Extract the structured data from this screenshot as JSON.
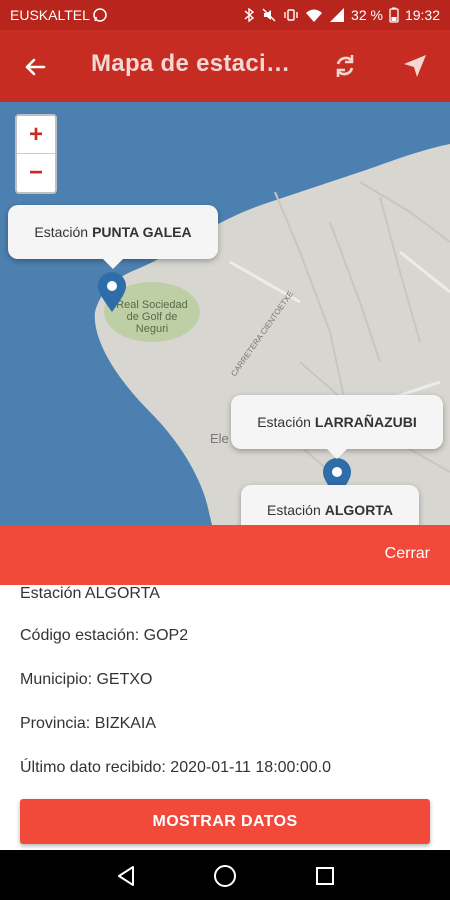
{
  "status_bar": {
    "carrier": "EUSKALTEL",
    "battery": "32 %",
    "time": "19:32",
    "icons": [
      "whatsapp-icon",
      "bluetooth-icon",
      "mute-icon",
      "vibrate-icon",
      "wifi-icon",
      "signal-icon",
      "battery-icon"
    ]
  },
  "app_bar": {
    "title": "Mapa de estaciones",
    "icons": [
      "back-arrow-icon",
      "refresh-icon",
      "location-arrow-icon"
    ]
  },
  "map": {
    "zoom_in_label": "+",
    "zoom_out_label": "−",
    "labels": {
      "golf": "Real Sociedad de Golf de Neguri",
      "golf_line1": "Real Sociedad",
      "golf_line2": "de Golf de",
      "golf_line3": "Neguri",
      "road": "CARRETERA CIENTOETXE",
      "place": "Ele"
    },
    "stations": [
      {
        "prefix": "Estación",
        "name": "PUNTA GALEA"
      },
      {
        "prefix": "Estación",
        "name": "LARRAÑAZUBI"
      },
      {
        "prefix": "Estación",
        "name": "ALGORTA"
      }
    ]
  },
  "panel": {
    "close_label": "Cerrar",
    "station_title": "Estación ALGORTA",
    "code": "Código estación: GOP2",
    "municipality": "Municipio: GETXO",
    "province": "Provincia: BIZKAIA",
    "last_data": "Último dato recibido: 2020-01-11 18:00:00.0",
    "button_label": "MOSTRAR DATOS"
  },
  "nav_bar": {
    "icons": [
      "back-triangle-icon",
      "home-circle-icon",
      "recents-square-icon"
    ]
  },
  "colors": {
    "status_bar": "#b8251d",
    "app_bar": "#c72c22",
    "accent": "#f24a3a",
    "sea": "#4c80b0",
    "land": "#d8d6d0",
    "marker": "#2f6da8"
  }
}
